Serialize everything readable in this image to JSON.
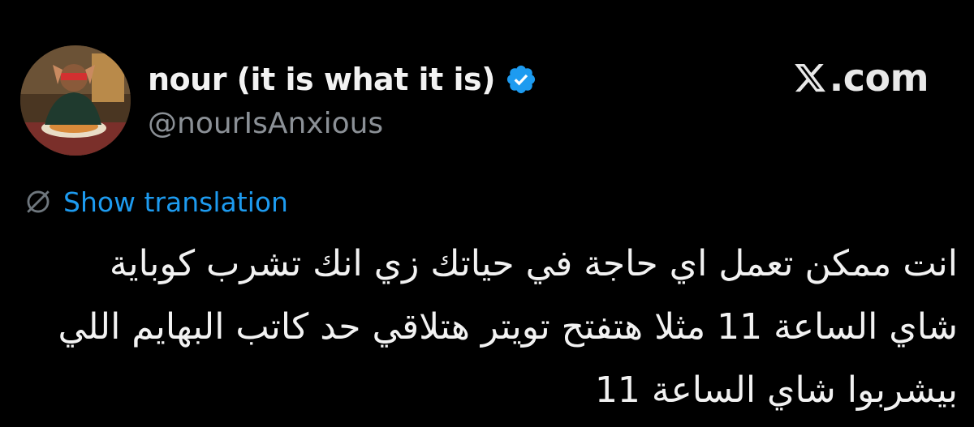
{
  "author": {
    "display_name": "nour (it is what it is)",
    "handle": "@nourIsAnxious",
    "verified": true
  },
  "brand": {
    "label": ".com",
    "logo": "x-logo-icon"
  },
  "translation": {
    "link_label": "Show translation",
    "icon": "globe-slash-icon"
  },
  "tweet": {
    "lines": [
      "انت ممكن تعمل اي حاجة في حياتك زي انك تشرب كوباية",
      "شاي الساعة 11 مثلا هتفتح تويتر هتلاقي حد كاتب البهايم اللي",
      "بيشربوا شاي الساعة 11"
    ]
  },
  "colors": {
    "background": "#000000",
    "text": "#f2f2f2",
    "muted": "#8b9096",
    "link": "#1d9bf0",
    "verified_badge": "#1d9bf0"
  }
}
